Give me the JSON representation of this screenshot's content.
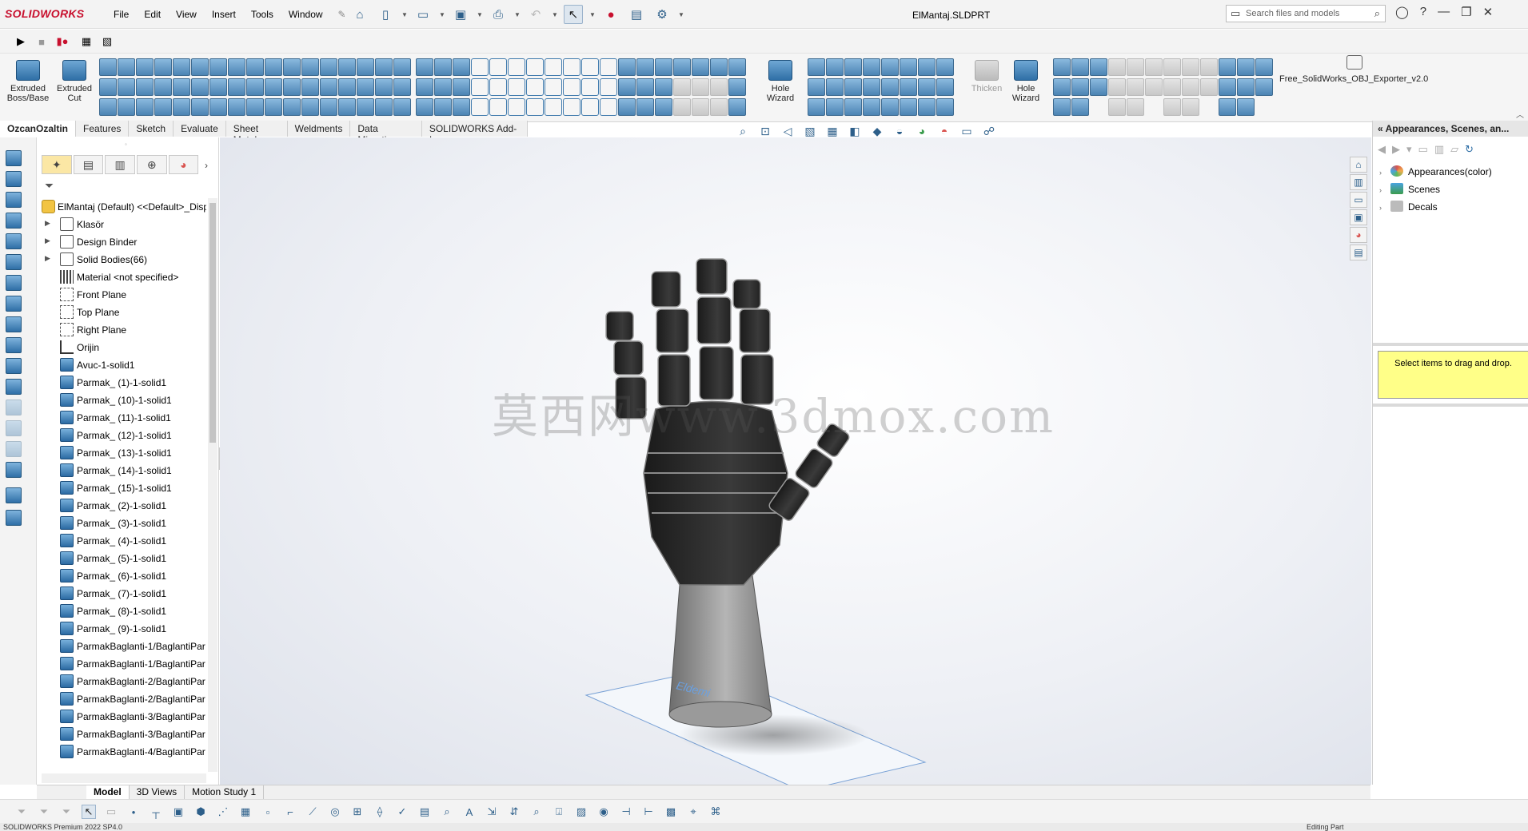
{
  "app": {
    "logo": "SOLIDWORKS",
    "document_title": "ElMantaj.SLDPRT"
  },
  "menu": [
    "File",
    "Edit",
    "View",
    "Insert",
    "Tools",
    "Window"
  ],
  "search": {
    "placeholder": "Search files and models"
  },
  "command_manager": {
    "buttons": [
      {
        "label": "Extruded\nBoss/Base"
      },
      {
        "label": "Extruded\nCut"
      },
      {
        "label": "Hole\nWizard"
      },
      {
        "label": "Thicken"
      },
      {
        "label": "Hole\nWizard"
      }
    ],
    "addin_label": "Free_SolidWorks_OBJ_Exporter_v2.0"
  },
  "tabs": [
    "OzcanOzaltin",
    "Features",
    "Sketch",
    "Evaluate",
    "Sheet Metal",
    "Weldments",
    "Data Migration",
    "SOLIDWORKS Add-Ins"
  ],
  "feature_tree": {
    "root": "ElMantaj (Default) <<Default>_Disp",
    "nodes": [
      {
        "label": "Klasör",
        "icon": "folder-icon",
        "expand": true
      },
      {
        "label": "Design Binder",
        "icon": "folder-icon",
        "expand": true
      },
      {
        "label": "Solid Bodies(66)",
        "icon": "folder-icon",
        "expand": true
      },
      {
        "label": "Material <not specified>",
        "icon": "material-icon",
        "expand": false
      },
      {
        "label": "Front Plane",
        "icon": "plane-icon",
        "expand": false
      },
      {
        "label": "Top Plane",
        "icon": "plane-icon",
        "expand": false
      },
      {
        "label": "Right Plane",
        "icon": "plane-icon",
        "expand": false
      },
      {
        "label": "Orijin",
        "icon": "origin-icon",
        "expand": false
      },
      {
        "label": "Avuc-1-solid1",
        "icon": "solid-body-icon",
        "expand": false
      },
      {
        "label": "Parmak_ (1)-1-solid1",
        "icon": "solid-body-icon",
        "expand": false
      },
      {
        "label": "Parmak_ (10)-1-solid1",
        "icon": "solid-body-icon",
        "expand": false
      },
      {
        "label": "Parmak_ (11)-1-solid1",
        "icon": "solid-body-icon",
        "expand": false
      },
      {
        "label": "Parmak_ (12)-1-solid1",
        "icon": "solid-body-icon",
        "expand": false
      },
      {
        "label": "Parmak_ (13)-1-solid1",
        "icon": "solid-body-icon",
        "expand": false
      },
      {
        "label": "Parmak_ (14)-1-solid1",
        "icon": "solid-body-icon",
        "expand": false
      },
      {
        "label": "Parmak_ (15)-1-solid1",
        "icon": "solid-body-icon",
        "expand": false
      },
      {
        "label": "Parmak_ (2)-1-solid1",
        "icon": "solid-body-icon",
        "expand": false
      },
      {
        "label": "Parmak_ (3)-1-solid1",
        "icon": "solid-body-icon",
        "expand": false
      },
      {
        "label": "Parmak_ (4)-1-solid1",
        "icon": "solid-body-icon",
        "expand": false
      },
      {
        "label": "Parmak_ (5)-1-solid1",
        "icon": "solid-body-icon",
        "expand": false
      },
      {
        "label": "Parmak_ (6)-1-solid1",
        "icon": "solid-body-icon",
        "expand": false
      },
      {
        "label": "Parmak_ (7)-1-solid1",
        "icon": "solid-body-icon",
        "expand": false
      },
      {
        "label": "Parmak_ (8)-1-solid1",
        "icon": "solid-body-icon",
        "expand": false
      },
      {
        "label": "Parmak_ (9)-1-solid1",
        "icon": "solid-body-icon",
        "expand": false
      },
      {
        "label": "ParmakBaglanti-1/BaglantiPar",
        "icon": "solid-body-icon",
        "expand": false
      },
      {
        "label": "ParmakBaglanti-1/BaglantiPar",
        "icon": "solid-body-icon",
        "expand": false
      },
      {
        "label": "ParmakBaglanti-2/BaglantiPar",
        "icon": "solid-body-icon",
        "expand": false
      },
      {
        "label": "ParmakBaglanti-2/BaglantiPar",
        "icon": "solid-body-icon",
        "expand": false
      },
      {
        "label": "ParmakBaglanti-3/BaglantiPar",
        "icon": "solid-body-icon",
        "expand": false
      },
      {
        "label": "ParmakBaglanti-3/BaglantiPar",
        "icon": "solid-body-icon",
        "expand": false
      },
      {
        "label": "ParmakBaglanti-4/BaglantiPar",
        "icon": "solid-body-icon",
        "expand": false
      }
    ]
  },
  "viewport": {
    "watermark": "莫西网www.3dmox.com",
    "base_text": "Eldemi"
  },
  "task_pane": {
    "title": "Appearances, Scenes, an...",
    "items": [
      {
        "label": "Appearances(color)",
        "color": "#d9534f"
      },
      {
        "label": "Scenes",
        "color": "#4aa3df"
      },
      {
        "label": "Decals",
        "color": "#999999"
      }
    ],
    "drop_hint": "Select items to drag and drop."
  },
  "bottom_tabs": [
    "Model",
    "3D Views",
    "Motion Study 1"
  ],
  "status": {
    "left": "SOLIDWORKS Premium 2022 SP4.0",
    "right": "Editing Part"
  },
  "colors": {
    "accent": "#2f6fa6",
    "brand": "#c8102e",
    "note_bg": "#ffff88"
  }
}
